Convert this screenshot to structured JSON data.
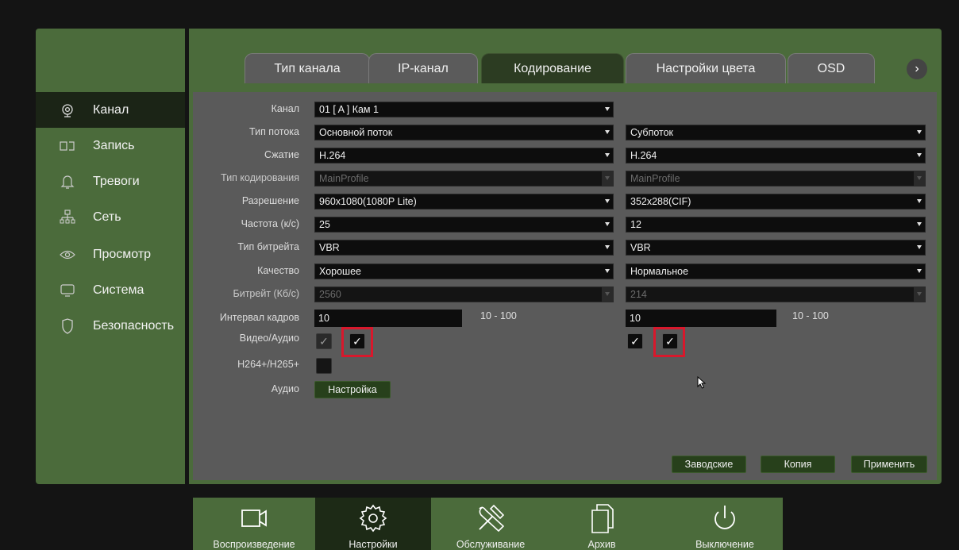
{
  "sidebar": {
    "items": [
      {
        "label": "Канал",
        "icon": "camera-icon",
        "active": true
      },
      {
        "label": "Запись",
        "icon": "record-icon"
      },
      {
        "label": "Тревоги",
        "icon": "bell-icon"
      },
      {
        "label": "Сеть",
        "icon": "network-icon"
      },
      {
        "label": "Просмотр",
        "icon": "eye-icon"
      },
      {
        "label": "Система",
        "icon": "monitor-icon"
      },
      {
        "label": "Безопасность",
        "icon": "shield-icon"
      }
    ]
  },
  "tabs": [
    {
      "label": "Тип канала"
    },
    {
      "label": "IP-канал"
    },
    {
      "label": "Кодирование",
      "active": true
    },
    {
      "label": "Настройки цвета"
    },
    {
      "label": "OSD"
    }
  ],
  "tab_next_glyph": "›",
  "form": {
    "channel": {
      "label": "Канал",
      "value": "01 [ A ] Кам 1"
    },
    "stream_type": {
      "label": "Тип потока",
      "main": "Основной поток",
      "sub": "Субпоток"
    },
    "compression": {
      "label": "Сжатие",
      "main": "H.264",
      "sub": "H.264"
    },
    "encoding_type": {
      "label": "Тип кодирования",
      "main": "MainProfile",
      "sub": "MainProfile"
    },
    "resolution": {
      "label": "Разрешение",
      "main": "960x1080(1080P Lite)",
      "sub": "352x288(CIF)"
    },
    "framerate": {
      "label": "Частота (к/с)",
      "main": "25",
      "sub": "12"
    },
    "bitrate_type": {
      "label": "Тип битрейта",
      "main": "VBR",
      "sub": "VBR"
    },
    "quality": {
      "label": "Качество",
      "main": "Хорошее",
      "sub": "Нормальное"
    },
    "bitrate": {
      "label": "Битрейт (Кб/с)",
      "main": "2560",
      "sub": "214"
    },
    "keyframe": {
      "label": "Интервал кадров",
      "main": "10",
      "sub": "10",
      "range_main": "10 - 100",
      "range_sub": "10 - 100"
    },
    "video_audio": {
      "label": "Видео/Аудио"
    },
    "h264plus": {
      "label": "H264+/H265+"
    },
    "audio": {
      "label": "Аудио",
      "button": "Настройка"
    }
  },
  "check_glyph": "✓",
  "actions": {
    "defaults": "Заводские",
    "copy": "Копия",
    "apply": "Применить"
  },
  "bottom_nav": [
    {
      "label": "Воспроизведение",
      "icon": "playback-camera-icon"
    },
    {
      "label": "Настройки",
      "icon": "settings-gear-icon",
      "active": true
    },
    {
      "label": "Обслуживание",
      "icon": "maintenance-tools-icon"
    },
    {
      "label": "Архив",
      "icon": "archive-files-icon"
    },
    {
      "label": "Выключение",
      "icon": "power-icon"
    }
  ],
  "colors": {
    "panel_green": "#4b6b3b",
    "active_dark": "#1b2416",
    "highlight_red": "#d8182c"
  }
}
